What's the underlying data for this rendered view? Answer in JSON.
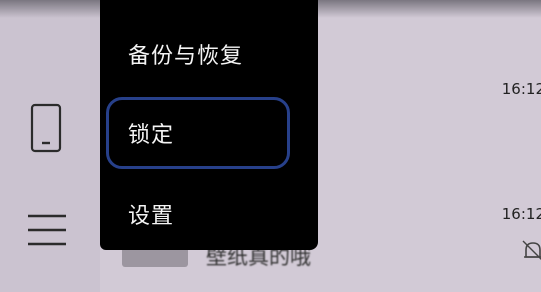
{
  "menu": {
    "items": [
      {
        "label": "备份与恢复"
      },
      {
        "label": "锁定",
        "focused": true
      },
      {
        "label": "设置"
      }
    ]
  },
  "sidebar": {
    "icons": [
      "phone-icon",
      "hamburger-menu-icon"
    ]
  },
  "list": {
    "items": [
      {
        "time": "16:12"
      },
      {
        "time": "16:12",
        "title": "壁纸真的哦",
        "icon": "bell-icon"
      }
    ]
  }
}
